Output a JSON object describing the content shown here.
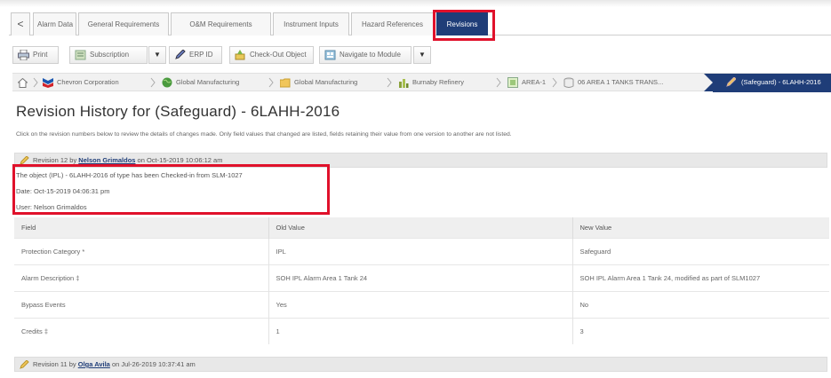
{
  "tabs": {
    "back": "<",
    "items": [
      "Alarm Data",
      "General Requirements",
      "O&M Requirements",
      "Instrument Inputs",
      "Hazard References",
      "Revisions"
    ]
  },
  "toolbar": {
    "print": "Print",
    "subscription": "Subscription",
    "erp_id": "ERP ID",
    "checkout": "Check-Out Object",
    "navigate": "Navigate to Module",
    "dropdown": "▼"
  },
  "breadcrumb": {
    "items": [
      "Chevron Corporation",
      "Global Manufacturing",
      "Global Manufacturing",
      "Burnaby Refinery",
      "AREA-1",
      "06 AREA 1 TANKS TRANS..."
    ],
    "active": "(Safeguard) - 6LAHH-2016"
  },
  "page": {
    "title": "Revision History for (Safeguard) - 6LAHH-2016",
    "note": "Click on the revision numbers below to review the details of changes made. Only field values that changed are listed, fields retaining their value from one version to another are not listed."
  },
  "revision12": {
    "prefix": "Revision 12 by ",
    "user": "Nelson Grimaldos",
    "suffix": " on Oct-15-2019 10:06:12 am",
    "lines": [
      "The object (IPL) - 6LAHH-2016 of type has been Checked-in from SLM-1027",
      "Date: Oct-15-2019 04:06:31 pm",
      "User: Nelson Grimaldos"
    ]
  },
  "table": {
    "headers": [
      "Field",
      "Old Value",
      "New Value"
    ],
    "rows": [
      [
        "Protection Category *",
        "IPL",
        "Safeguard"
      ],
      [
        "Alarm Description ‡",
        "SOH IPL Alarm Area 1 Tank 24",
        "SOH IPL Alarm Area 1 Tank 24, modified as part of SLM1027"
      ],
      [
        "Bypass Events",
        "Yes",
        "No"
      ],
      [
        "Credits ‡",
        "1",
        "3"
      ]
    ]
  },
  "revision11": {
    "prefix": "Revision 11 by ",
    "user": "Olga Avila",
    "suffix": " on Jul-26-2019 10:37:41 am"
  },
  "colors": {
    "accent": "#1f3d78",
    "highlight": "#e0112b"
  }
}
